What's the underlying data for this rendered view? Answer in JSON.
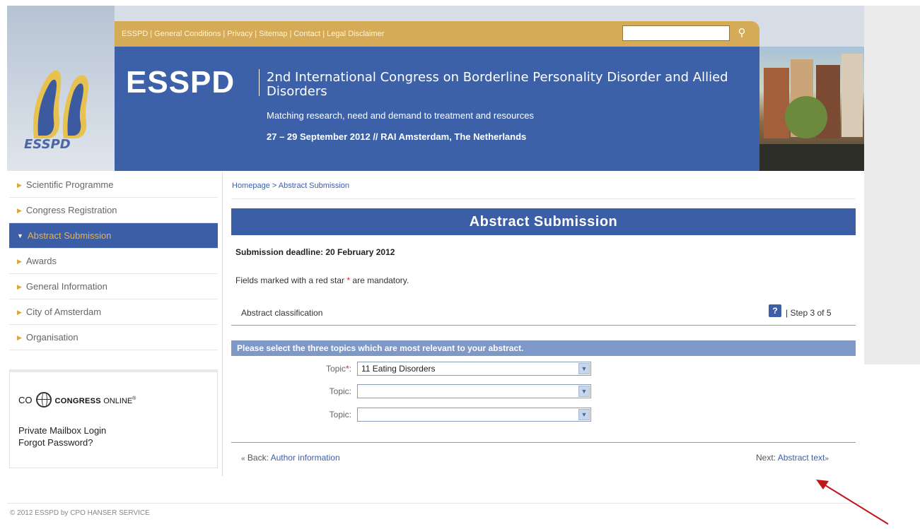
{
  "header": {
    "top_nav": [
      "ESSPD",
      "General Conditions",
      "Privacy",
      "Sitemap",
      "Contact",
      "Legal Disclaimer"
    ],
    "search": {
      "value": "",
      "placeholder": ""
    },
    "logo_text": "ESSPD",
    "banner": {
      "logo": "ESSPD",
      "title": "2nd International Congress on Borderline Personality Disorder and Allied Disorders",
      "subtitle": "Matching research, need and demand to treatment and resources",
      "date": "27 – 29 September 2012 // RAI Amsterdam, The Netherlands"
    }
  },
  "sidebar": {
    "items": [
      {
        "label": "Scientific Programme",
        "active": false
      },
      {
        "label": "Congress Registration",
        "active": false
      },
      {
        "label": "Abstract Submission",
        "active": true
      },
      {
        "label": "Awards",
        "active": false
      },
      {
        "label": "General Information",
        "active": false
      },
      {
        "label": "City of Amsterdam",
        "active": false
      },
      {
        "label": "Organisation",
        "active": false
      }
    ],
    "congress_online": {
      "co": "CO",
      "brand": "CONGRESS",
      "brand_suffix": "ONLINE",
      "reg": "®",
      "links": [
        "Private Mailbox Login",
        "Forgot Password?"
      ]
    }
  },
  "main": {
    "breadcrumb": [
      "Homepage",
      "Abstract Submission"
    ],
    "breadcrumb_sep": ">",
    "title": "Abstract Submission",
    "deadline": "Submission deadline: 20 February 2012",
    "mandatory_prefix": "Fields marked with a red star",
    "mandatory_star": "*",
    "mandatory_suffix": "are mandatory.",
    "section_label": "Abstract classification",
    "help": "?",
    "step": "| Step 3 of 5",
    "topics_heading": "Please select the three topics which are most relevant to your abstract.",
    "topics": [
      {
        "label": "Topic",
        "required": true,
        "value": "11 Eating Disorders"
      },
      {
        "label": "Topic",
        "required": false,
        "value": ""
      },
      {
        "label": "Topic",
        "required": false,
        "value": ""
      }
    ],
    "back": {
      "prefix": "Back:",
      "link": "Author information"
    },
    "next": {
      "prefix": "Next:",
      "link": "Abstract text"
    }
  },
  "footer": "© 2012 ESSPD by CPO HANSER SERVICE",
  "colors": {
    "primary": "#3c5ea6",
    "gold": "#d6ab57",
    "topics_bar": "#7e98c8",
    "required": "#dd2222",
    "annotation": "#c0161a"
  }
}
